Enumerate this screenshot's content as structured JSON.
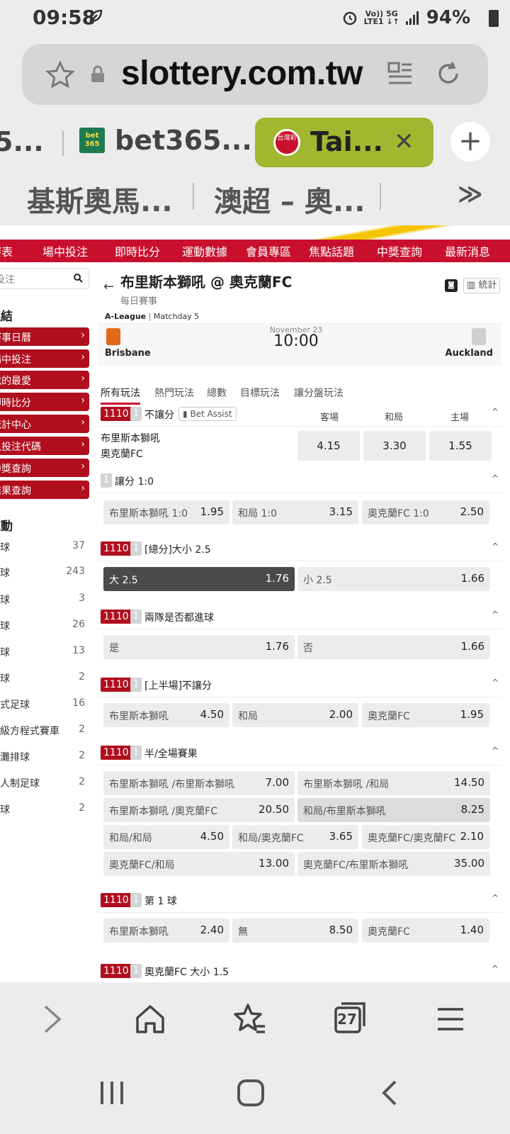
{
  "status": {
    "time": "09:58",
    "net_top": "Vo)) 5G",
    "net_bottom": "LTE1 ↓↑",
    "battery": "94%"
  },
  "browser": {
    "url": "slottery.com.tw",
    "tabs": [
      {
        "label": "5..."
      },
      {
        "label": "bet365...",
        "logo": "bet 365"
      },
      {
        "label": "Tai...",
        "logo": "台灣彩"
      }
    ],
    "bookmarks": [
      "基斯奧馬...",
      "澳超 – 奧...",
      "≫"
    ]
  },
  "site_nav": [
    "賽表",
    "場中投注",
    "即時比分",
    "運動數據",
    "會員專區",
    "焦點話題",
    "中獎查詢",
    "最新消息"
  ],
  "sidebar": {
    "search_placeholder": "投注",
    "section1": "連結",
    "links": [
      "賽事日曆",
      "場中投注",
      "我的最愛",
      "即時比分",
      "統計中心",
      "輸入投注代碼",
      "中獎查詢",
      "結果查詢"
    ],
    "section2": "運動",
    "sports": [
      {
        "name": "足球",
        "count": "37"
      },
      {
        "name": "籃球",
        "count": "243"
      },
      {
        "name": "棒球",
        "count": "3"
      },
      {
        "name": "網球",
        "count": "26"
      },
      {
        "name": "冰球",
        "count": "13"
      },
      {
        "name": "排球",
        "count": "2"
      },
      {
        "name": "美式足球",
        "count": "16"
      },
      {
        "name": "一級方程式賽車",
        "count": "2"
      },
      {
        "name": "沙灘排球",
        "count": "2"
      },
      {
        "name": "五人制足球",
        "count": "2"
      },
      {
        "name": "手球",
        "count": "2"
      }
    ]
  },
  "match": {
    "title": "布里斯本獅吼 @ 奧克蘭FC",
    "subtitle": "每日賽事",
    "stats_label": "統計",
    "league": "A-League",
    "matchday": "Matchday 5",
    "date": "November 23",
    "kickoff": "10:00",
    "home": "Brisbane",
    "away": "Auckland"
  },
  "market_tabs": [
    "所有玩法",
    "熱門玩法",
    "總數",
    "目標玩法",
    "讓分盤玩法"
  ],
  "markets": {
    "m1": {
      "code": "1110",
      "num": "1",
      "name": "不讓分",
      "bet_assist": "Bet Assist",
      "cols": [
        "客場",
        "和局",
        "主場"
      ],
      "team1": "布里斯本獅吼",
      "team2": "奧克蘭FC",
      "odds": [
        "4.15",
        "3.30",
        "1.55"
      ]
    },
    "m2": {
      "num": "1",
      "name": "讓分 1:0",
      "opts": [
        {
          "l": "布里斯本獅吼 1:0",
          "v": "1.95"
        },
        {
          "l": "和局 1:0",
          "v": "3.15"
        },
        {
          "l": "奧克蘭FC 1:0",
          "v": "2.50"
        }
      ]
    },
    "m3": {
      "code": "1110",
      "num": "1",
      "name": "[總分]大小 2.5",
      "opts": [
        {
          "l": "大 2.5",
          "v": "1.76"
        },
        {
          "l": "小 2.5",
          "v": "1.66"
        }
      ]
    },
    "m4": {
      "code": "1110",
      "num": "1",
      "name": "兩隊是否都進球",
      "opts": [
        {
          "l": "是",
          "v": "1.76"
        },
        {
          "l": "否",
          "v": "1.66"
        }
      ]
    },
    "m5": {
      "code": "1110",
      "num": "1",
      "name": "[上半場]不讓分",
      "opts": [
        {
          "l": "布里斯本獅吼",
          "v": "4.50"
        },
        {
          "l": "和局",
          "v": "2.00"
        },
        {
          "l": "奧克蘭FC",
          "v": "1.95"
        }
      ]
    },
    "m6": {
      "code": "1110",
      "num": "1",
      "name": "半/全場賽果",
      "opts": [
        {
          "l": "布里斯本獅吼 /布里斯本獅吼",
          "v": "7.00"
        },
        {
          "l": "布里斯本獅吼 /和局",
          "v": "14.50"
        },
        {
          "l": "布里斯本獅吼 /奧克蘭FC",
          "v": "20.50"
        },
        {
          "l": "和局/布里斯本獅吼",
          "v": "8.25"
        },
        {
          "l": "和局/和局",
          "v": "4.50"
        },
        {
          "l": "和局/奧克蘭FC",
          "v": "3.65"
        },
        {
          "l": "奧克蘭FC/奧克蘭FC",
          "v": "2.10"
        },
        {
          "l": "奧克蘭FC/和局",
          "v": "13.00"
        },
        {
          "l": "奧克蘭FC/布里斯本獅吼",
          "v": "35.00"
        }
      ]
    },
    "m7": {
      "code": "1110",
      "num": "1",
      "name": "第 1 球",
      "opts": [
        {
          "l": "布里斯本獅吼",
          "v": "2.40"
        },
        {
          "l": "無",
          "v": "8.50"
        },
        {
          "l": "奧克蘭FC",
          "v": "1.40"
        }
      ]
    },
    "m8": {
      "code": "1110",
      "num": "1",
      "name": "奧克蘭FC 大小 1.5"
    }
  },
  "bottom_nav": {
    "tabs_count": "27"
  }
}
